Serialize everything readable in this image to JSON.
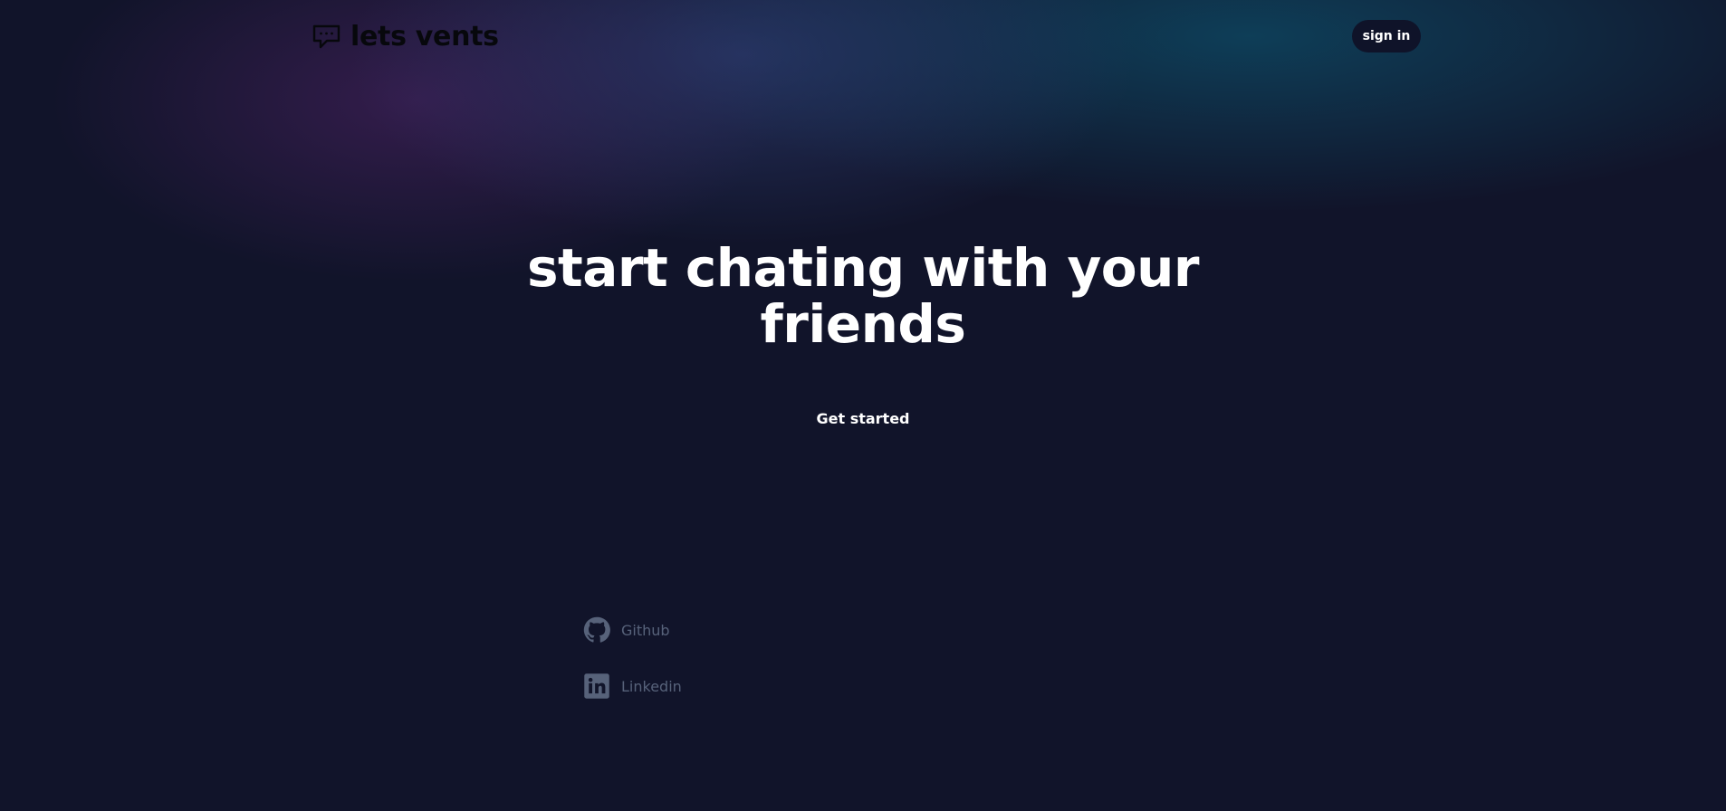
{
  "header": {
    "logo_icon": "chat-bubble-icon",
    "brand": "lets vents",
    "signin_label": "sign in"
  },
  "hero": {
    "title": "start chating with your friends",
    "cta_label": "Get started"
  },
  "footer": {
    "links": [
      {
        "icon": "github-icon",
        "label": "Github"
      },
      {
        "icon": "linkedin-icon",
        "label": "Linkedin"
      }
    ]
  },
  "colors": {
    "background": "#11142a",
    "button_bg": "#0f1329",
    "text_primary": "#ffffff",
    "brand_text": "#07080c",
    "link_muted": "#57627a"
  }
}
